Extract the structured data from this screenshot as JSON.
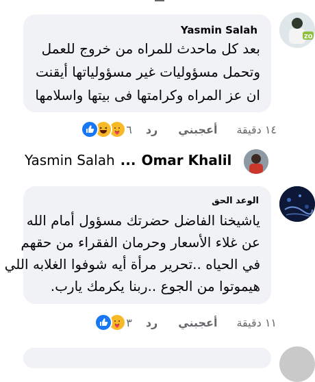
{
  "comment1": {
    "author": "Yasmin Salah",
    "lines": [
      "بعد كل ماحدث للمراه من خروج للعمل",
      "وتحمل مسؤوليات غير مسؤولياتها أيقنت",
      "ان عز المراه وكرامتها فى بيتها واسلامها"
    ],
    "time": "١٤ دقيقة",
    "like_label": "أعجبني",
    "reply_label": "رد",
    "reaction_count": "٦",
    "reactions": [
      "like-icon",
      "haha-icon",
      "care-icon"
    ]
  },
  "reply_preview": {
    "author": "Omar Khalil",
    "arrow": "...",
    "target": "Yasmin Salah"
  },
  "comment2": {
    "author": "الوعد الحق",
    "lines": [
      "ياشيخنا الفاضل حضرتك مسؤول أمام الله",
      "عن غلاء الأسعار وحرمان الفقراء من حقهم",
      "في الحياه ..تحرير مرأة أيه شوفوا الغلابه اللي",
      "هيموتوا من الجوع ..ربنا يكرمك يارب."
    ],
    "time": "١١ دقيقة",
    "like_label": "أعجبني",
    "reply_label": "رد",
    "reaction_count": "٣",
    "reactions": [
      "like-icon",
      "care-icon"
    ]
  },
  "colors": {
    "bubble": "#f0f2f5",
    "meta_text": "#65676b",
    "like_blue": "#1877f2",
    "haha_yellow": "#f7b928"
  }
}
